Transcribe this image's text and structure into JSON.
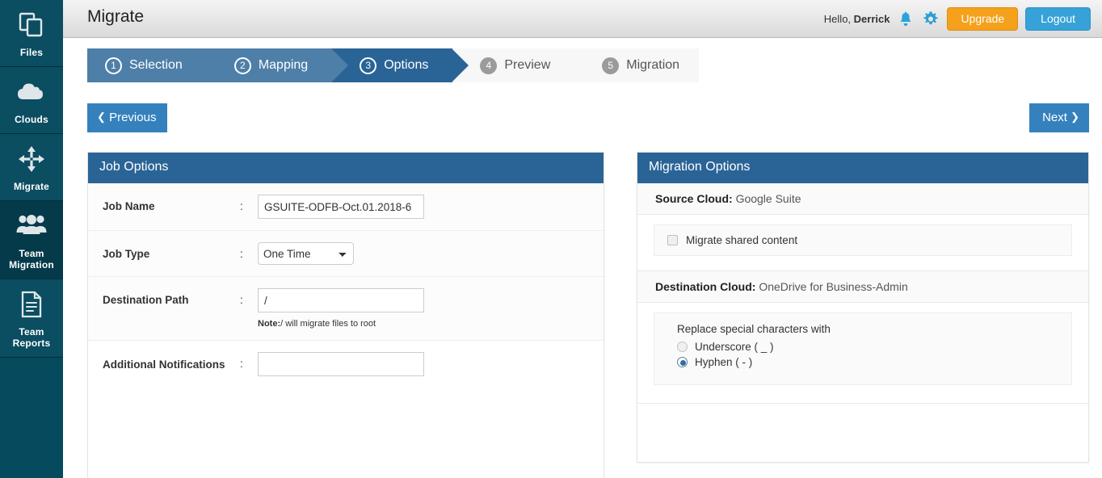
{
  "sidebar": {
    "items": [
      {
        "label": "Files",
        "icon": "files-icon",
        "active": false
      },
      {
        "label": "Clouds",
        "icon": "cloud-icon",
        "active": false
      },
      {
        "label": "Migrate",
        "icon": "move-arrows-icon",
        "active": false
      },
      {
        "label": "Team\nMigration",
        "icon": "team-icon",
        "active": true
      },
      {
        "label": "Team\nReports",
        "icon": "document-icon",
        "active": false
      }
    ]
  },
  "header": {
    "title": "Migrate",
    "greeting_prefix": "Hello, ",
    "user_name": "Derrick",
    "bell_icon": "bell-icon",
    "gear_icon": "gear-icon",
    "upgrade_label": "Upgrade",
    "logout_label": "Logout",
    "upgrade_color": "#f5a11b",
    "logout_color": "#36a2d8"
  },
  "wizard": {
    "steps": [
      {
        "num": "1",
        "label": "Selection",
        "state": "done"
      },
      {
        "num": "2",
        "label": "Mapping",
        "state": "done"
      },
      {
        "num": "3",
        "label": "Options",
        "state": "active"
      },
      {
        "num": "4",
        "label": "Preview",
        "state": "todo"
      },
      {
        "num": "5",
        "label": "Migration",
        "state": "todo"
      }
    ],
    "active_color": "#2a6496",
    "done_color": "#4e7fa8",
    "todo_color": "#f7f7f7"
  },
  "nav": {
    "previous_label": "Previous",
    "next_label": "Next",
    "previous_chevron": "chevron-left-icon",
    "next_chevron": "chevron-right-icon"
  },
  "job_options": {
    "title": "Job Options",
    "job_name": {
      "label": "Job Name",
      "colon": ":",
      "value": "GSUITE-ODFB-Oct.01.2018-6"
    },
    "job_type": {
      "label": "Job Type",
      "colon": ":",
      "value": "One Time",
      "options": [
        "One Time"
      ]
    },
    "destination_path": {
      "label": "Destination Path",
      "colon": ":",
      "value": "/",
      "note_bold": "Note:",
      "note_text": "/ will migrate files to root"
    },
    "additional_notifications": {
      "label": "Additional Notifications",
      "colon": ":",
      "value": "",
      "placeholder": ""
    }
  },
  "migration_options": {
    "title": "Migration Options",
    "source_cloud": {
      "label": "Source Cloud:",
      "value": "Google Suite"
    },
    "destination_cloud": {
      "label": "Destination Cloud:",
      "value": "OneDrive for Business-Admin"
    },
    "shared_content": {
      "label": "Migrate shared content",
      "checked": false
    },
    "replace_chars": {
      "title": "Replace special characters with",
      "options": [
        {
          "label": "Underscore ( _ )",
          "selected": false
        },
        {
          "label": "Hyphen ( - )",
          "selected": true
        }
      ]
    }
  }
}
